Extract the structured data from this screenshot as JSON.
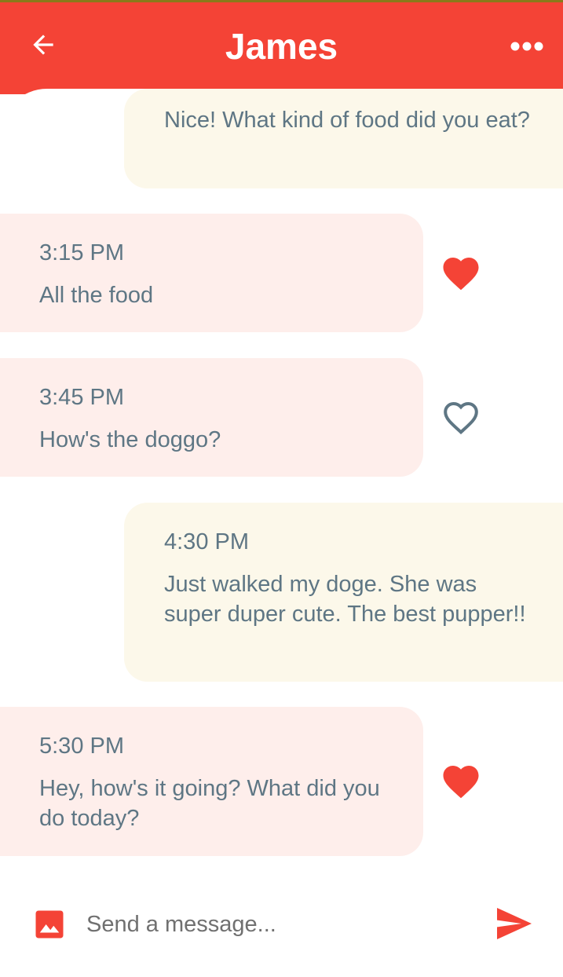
{
  "colors": {
    "primary": "#f44336",
    "sent_bubble": "#fcf8ea",
    "received_bubble": "#feeeeb",
    "text": "#5e7684"
  },
  "header": {
    "title": "James",
    "back_icon": "arrow-left-icon",
    "more_icon": "more-horizontal-icon"
  },
  "messages": [
    {
      "direction": "sent",
      "time": "",
      "text": "Nice! What kind of food did you eat?"
    },
    {
      "direction": "received",
      "time": "3:15 PM",
      "text": "All the food",
      "liked": true
    },
    {
      "direction": "received",
      "time": "3:45 PM",
      "text": "How's the doggo?",
      "liked": false
    },
    {
      "direction": "sent",
      "time": "4:30 PM",
      "text": "Just walked my doge. She was super duper cute. The best pupper!!"
    },
    {
      "direction": "received",
      "time": "5:30 PM",
      "text": "Hey, how's it going? What did you do today?",
      "liked": true
    }
  ],
  "composer": {
    "placeholder": "Send a message...",
    "image_icon": "image-icon",
    "send_icon": "send-icon"
  }
}
